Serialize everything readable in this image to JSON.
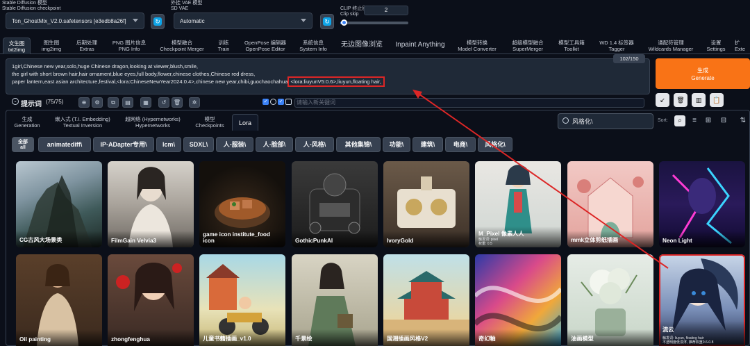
{
  "top": {
    "ckpt_label_en": "Stable Diffusion 模型",
    "ckpt_label_sub": "Stable Diffusion checkpoint",
    "ckpt_value": "Ton_GhostMix_V2.0.safetensors [e3edb8a26f]",
    "vae_label": "外挂 VAE 模型",
    "vae_label_sub": "SD VAE",
    "vae_value": "Automatic",
    "clip_label": "CLIP 终止层数",
    "clip_label_sub": "Clip skip",
    "clip_value": "2",
    "clip_fraction": 0.05
  },
  "tabs": [
    {
      "l1": "文生图",
      "l2": "txt2img"
    },
    {
      "l1": "图生图",
      "l2": "img2img"
    },
    {
      "l1": "后期处理",
      "l2": "Extras"
    },
    {
      "l1": "PNG 图片信息",
      "l2": "PNG Info"
    },
    {
      "l1": "模型融合",
      "l2": "Checkpoint Merger"
    },
    {
      "l1": "训练",
      "l2": "Train"
    },
    {
      "l1": "OpenPose 编辑器",
      "l2": "OpenPose Editor"
    },
    {
      "l1": "系统信息",
      "l2": "System Info"
    },
    {
      "l1": "无边图像浏览",
      "l2": ""
    },
    {
      "l1": "Inpaint Anything",
      "l2": ""
    },
    {
      "l1": "模型转换",
      "l2": "Model Converter"
    },
    {
      "l1": "超级模型融合",
      "l2": "SuperMerger"
    },
    {
      "l1": "模型工具箱",
      "l2": "Toolkit"
    },
    {
      "l1": "WD 1.4 标签器",
      "l2": "Tagger"
    },
    {
      "l1": "通配符管理",
      "l2": "Wildcards Manager"
    },
    {
      "l1": "设置",
      "l2": "Settings"
    },
    {
      "l1": "扩",
      "l2": "Exte"
    }
  ],
  "prompt": {
    "line1": "1girl,Chinese new year,solo,huge Chinese dragon,looking at viewer,blush,smile,",
    "line2": "the girl with short brown hair,hair ornament,blue eyes,full body,flower,chinese clothes,Chinese red dress,",
    "line3_a": "paper lantern,east asian architecture,festival,<lora:ChineseNewYear2024:0.4>,chinese new year,chibi,guochaochahua,",
    "line3_hl": "<lora:liuyunV5:0.6>,liuyun,floating hair,",
    "counter": "102/150"
  },
  "generate": {
    "l1": "生成",
    "l2": "Generate"
  },
  "tools": [
    "↙",
    "🗑",
    "▥",
    "📋"
  ],
  "toolbar": {
    "prompt_label": "提示词",
    "prompt_count": "(75/75)",
    "tag_placeholder": "请输入新关键词"
  },
  "network_tabs": [
    {
      "l1": "生成",
      "l2": "Generation"
    },
    {
      "l1": "嵌入式 (T.I. Embedding)",
      "l2": "Textual Inversion"
    },
    {
      "l1": "超网络 (Hypernetworks)",
      "l2": "Hypernetworks"
    },
    {
      "l1": "模型",
      "l2": "Checkpoints"
    },
    {
      "l1": "Lora",
      "l2": ""
    }
  ],
  "search": {
    "value": "风格化\\"
  },
  "sort": {
    "label": "Sort:"
  },
  "filters": [
    {
      "l1": "全部",
      "l2": "all"
    },
    {
      "l1": "animatediff\\",
      "l2": ""
    },
    {
      "l1": "IP-ADapter专用\\",
      "l2": ""
    },
    {
      "l1": "lcm\\",
      "l2": ""
    },
    {
      "l1": "SDXL\\",
      "l2": ""
    },
    {
      "l1": "人-服装\\",
      "l2": ""
    },
    {
      "l1": "人-脸部\\",
      "l2": ""
    },
    {
      "l1": "人-风格\\",
      "l2": ""
    },
    {
      "l1": "其他集锦\\",
      "l2": ""
    },
    {
      "l1": "功能\\",
      "l2": ""
    },
    {
      "l1": "建筑\\",
      "l2": ""
    },
    {
      "l1": "电商\\",
      "l2": ""
    },
    {
      "l1": "风格化\\",
      "l2": ""
    }
  ],
  "cards_row1": [
    {
      "label": "CG古风大场景类",
      "sub": ""
    },
    {
      "label": "FilmGain Velvia3",
      "sub": ""
    },
    {
      "label": "game icon institute_food icon",
      "sub": ""
    },
    {
      "label": "GothicPunkAI",
      "sub": ""
    },
    {
      "label": "IvoryGold",
      "sub": ""
    },
    {
      "label": "M_Pixel 像素人人",
      "sub": "触发词: pixel\n权重: 0.5"
    },
    {
      "label": "mmk立体剪纸插画",
      "sub": ""
    },
    {
      "label": "Neon Light",
      "sub": ""
    }
  ],
  "cards_row2": [
    {
      "label": "Oil painting",
      "sub": ""
    },
    {
      "label": "zhongfenghua",
      "sub": ""
    },
    {
      "label": "儿童书籍插画_v1.0",
      "sub": ""
    },
    {
      "label": "千景绘",
      "sub": ""
    },
    {
      "label": "国潮插画风格V2",
      "sub": ""
    },
    {
      "label": "奇幻釉",
      "sub": ""
    },
    {
      "label": "油画模型",
      "sub": ""
    },
    {
      "label": "流云",
      "sub": "触发词: liuyun, floating hair\n不透明度低漂浮, 推荐权重0.6-0.8"
    }
  ],
  "colors": {
    "accent": "#f97316",
    "highlight": "#dc2626",
    "bg": "#0b0f19"
  }
}
